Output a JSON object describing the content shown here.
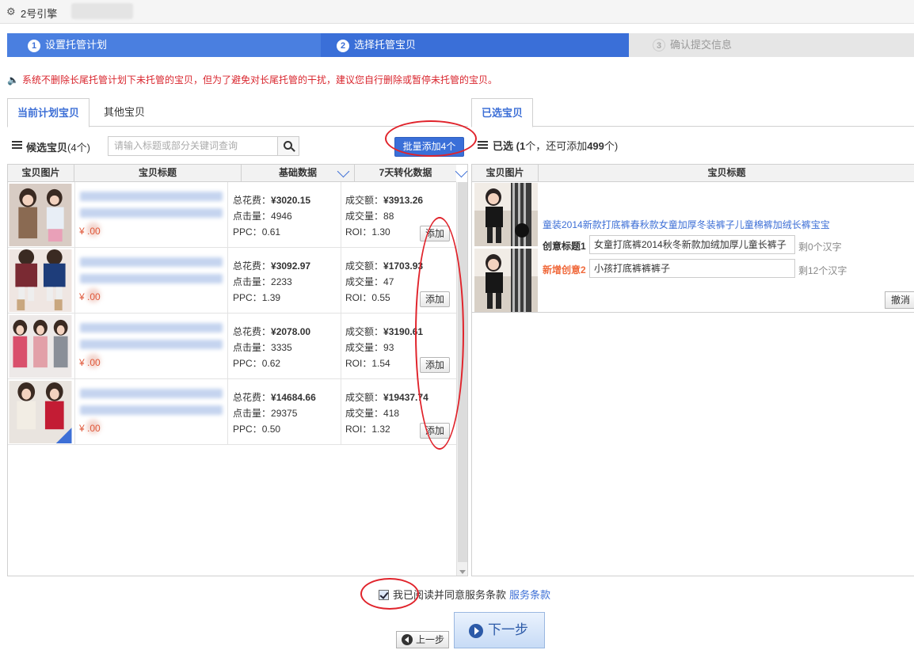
{
  "app": {
    "title": "2号引擎"
  },
  "steps": [
    {
      "num": "1",
      "label": "设置托管计划"
    },
    {
      "num": "2",
      "label": "选择托管宝贝"
    },
    {
      "num": "3",
      "label": "确认提交信息"
    }
  ],
  "notice": "系统不删除长尾托管计划下未托管的宝贝，但为了避免对长尾托管的干扰，建议您自行删除或暂停未托管的宝贝。",
  "left_tabs": [
    "当前计划宝贝",
    "其他宝贝"
  ],
  "right_tab": "已选宝贝",
  "candidates": {
    "label": "候选宝贝",
    "count": "(4个)",
    "search_placeholder": "请输入标题或部分关键词查询",
    "batch_button": "批量添加4个"
  },
  "selected_info": {
    "prefix": "已选 (",
    "count": "1",
    "mid": "个，还可添加",
    "remain": "499",
    "suffix": "个)"
  },
  "left_headers": [
    "宝贝图片",
    "宝贝标题",
    "基础数据",
    "7天转化数据"
  ],
  "right_headers": [
    "宝贝图片",
    "宝贝标题"
  ],
  "labels": {
    "spend": "总花费：",
    "clicks": "点击量：",
    "ppc": "PPC：",
    "gmv": "成交额：",
    "orders": "成交量：",
    "roi": "ROI：",
    "add": "添加"
  },
  "rows": [
    {
      "price": "¥  .00",
      "spend": "¥3020.15",
      "clicks": "4946",
      "ppc": "0.61",
      "gmv": "¥3913.26",
      "orders": "88",
      "roi": "1.30"
    },
    {
      "price": "¥  .00",
      "spend": "¥3092.97",
      "clicks": "2233",
      "ppc": "1.39",
      "gmv": "¥1703.93",
      "orders": "47",
      "roi": "0.55"
    },
    {
      "price": "¥  .00",
      "spend": "¥2078.00",
      "clicks": "3335",
      "ppc": "0.62",
      "gmv": "¥3190.61",
      "orders": "93",
      "roi": "1.54"
    },
    {
      "price": "¥  .00",
      "spend": "¥14684.66",
      "clicks": "29375",
      "ppc": "0.50",
      "gmv": "¥19437.74",
      "orders": "418",
      "roi": "1.32"
    }
  ],
  "selected_item": {
    "title": "童装2014新款打底裤春秋款女童加厚冬装裤子儿童棉裤加绒长裤宝宝",
    "creative1_label": "创意标题1",
    "creative1_value": "女童打底裤2014秋冬新款加绒加厚儿童长裤子",
    "creative1_remain": "剩0个汉字",
    "creative2_label": "新增创意2",
    "creative2_value": "小孩打底裤裤裤子",
    "creative2_remain": "剩12个汉字",
    "cancel": "撤消"
  },
  "agree": {
    "text": "我已阅读并同意服务条款",
    "link": "服务条款"
  },
  "nav": {
    "prev": "上一步",
    "next": "下一步"
  },
  "colors": {
    "accent": "#3a6fd8",
    "warning": "#d9262e",
    "annotation": "#e0232b"
  }
}
